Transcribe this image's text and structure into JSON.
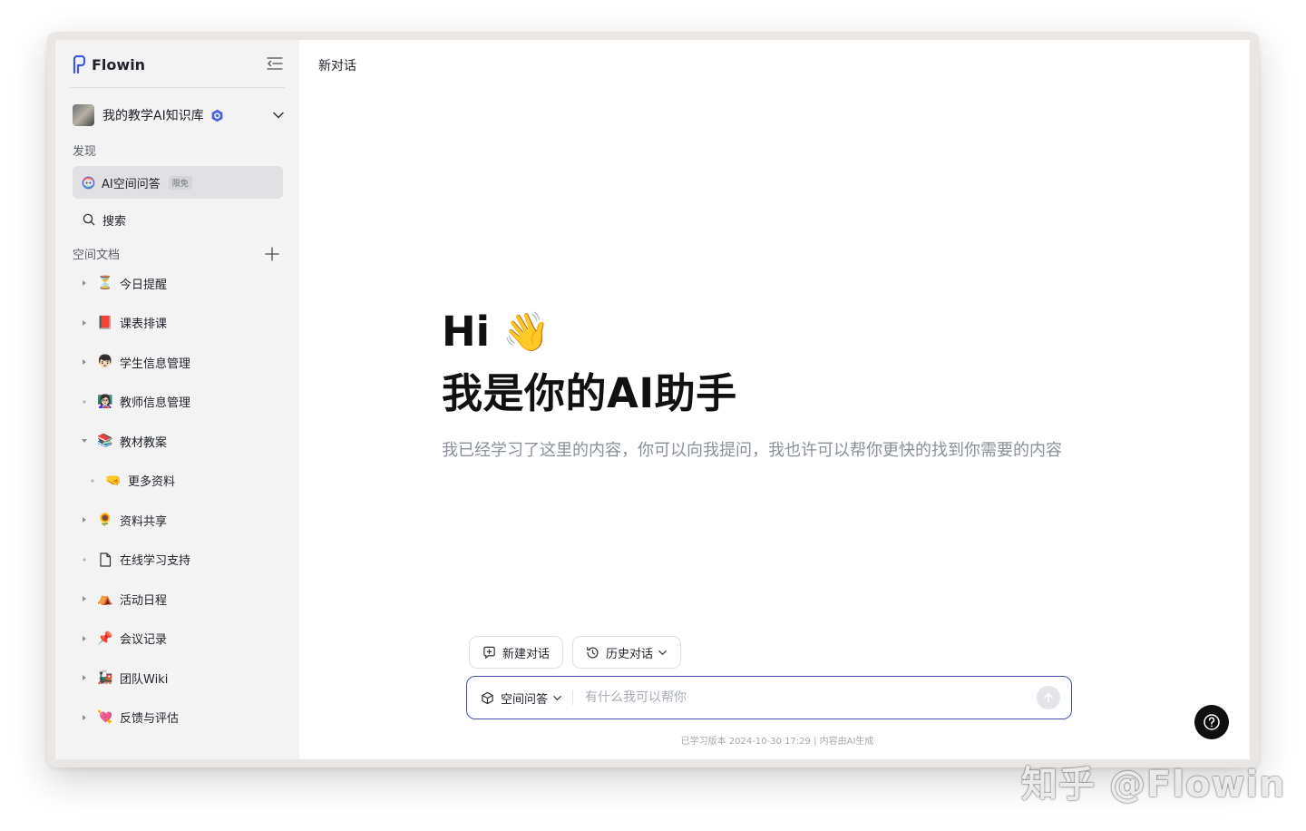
{
  "app": {
    "name": "Flowin"
  },
  "space": {
    "name": "我的教学AI知识库"
  },
  "sidebar": {
    "discover_label": "发现",
    "ai_qa": {
      "label": "AI空间问答",
      "badge": "限免"
    },
    "search_label": "搜索",
    "docs_label": "空间文档",
    "docs": [
      {
        "emoji": "⏳",
        "label": "今日提醒",
        "toggle": "collapsed"
      },
      {
        "emoji": "📕",
        "label": "课表排课",
        "toggle": "collapsed"
      },
      {
        "emoji": "👦🏻",
        "label": "学生信息管理",
        "toggle": "collapsed"
      },
      {
        "emoji": "👩🏻‍🏫",
        "label": "教师信息管理",
        "toggle": "dot"
      },
      {
        "emoji": "📚",
        "label": "教材教案",
        "toggle": "expanded"
      },
      {
        "emoji": "🤜",
        "label": "更多资料",
        "toggle": "dot",
        "child": true
      },
      {
        "emoji": "🌻",
        "label": "资料共享",
        "toggle": "collapsed"
      },
      {
        "emoji": "page",
        "label": "在线学习支持",
        "toggle": "dot"
      },
      {
        "emoji": "⛺",
        "label": "活动日程",
        "toggle": "collapsed"
      },
      {
        "emoji": "📌",
        "label": "会议记录",
        "toggle": "collapsed"
      },
      {
        "emoji": "🚂",
        "label": "团队Wiki",
        "toggle": "collapsed"
      },
      {
        "emoji": "💘",
        "label": "反馈与评估",
        "toggle": "collapsed"
      }
    ]
  },
  "main": {
    "title": "新对话",
    "hero": {
      "greeting": "Hi",
      "wave": "👋",
      "title": "我是你的AI助手",
      "subtitle": "我已经学习了这里的内容，你可以向我提问，我也许可以帮你更快的找到你需要的内容"
    },
    "chips": {
      "new_chat": "新建对话",
      "history": "历史对话"
    },
    "input": {
      "mode": "空间问答",
      "placeholder": "有什么我可以帮你",
      "value": ""
    },
    "footnote": "已学习版本 2024-10-30 17:29 | 内容由AI生成"
  },
  "watermark": "知乎 @Flowin",
  "colors": {
    "accent": "#434cb8",
    "brand_blue": "#3b5bdb",
    "sidebar_bg": "#f3f3f4",
    "active_bg": "#e1e1e3"
  }
}
